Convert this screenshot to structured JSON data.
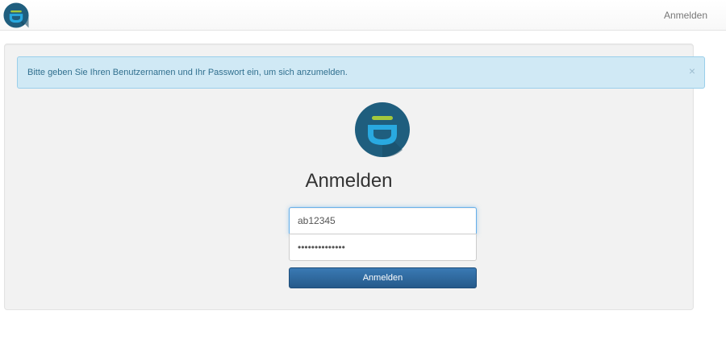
{
  "navbar": {
    "login_link": "Anmelden",
    "logo_icon": "privacyidea-logo-icon"
  },
  "alert": {
    "message": "Bitte geben Sie Ihren Benutzernamen und Ihr Passwort ein, um sich anzumelden.",
    "close_symbol": "×"
  },
  "login": {
    "title": "Anmelden",
    "username_value": "ab12345",
    "password_value": "••••••••••••••",
    "submit_label": "Anmelden"
  },
  "colors": {
    "logo_bg": "#1f5e7e",
    "logo_cup": "#29a9e0",
    "logo_accent": "#a4c83c",
    "button": "#2d6ca2",
    "alert_bg": "#d0e9f5"
  }
}
